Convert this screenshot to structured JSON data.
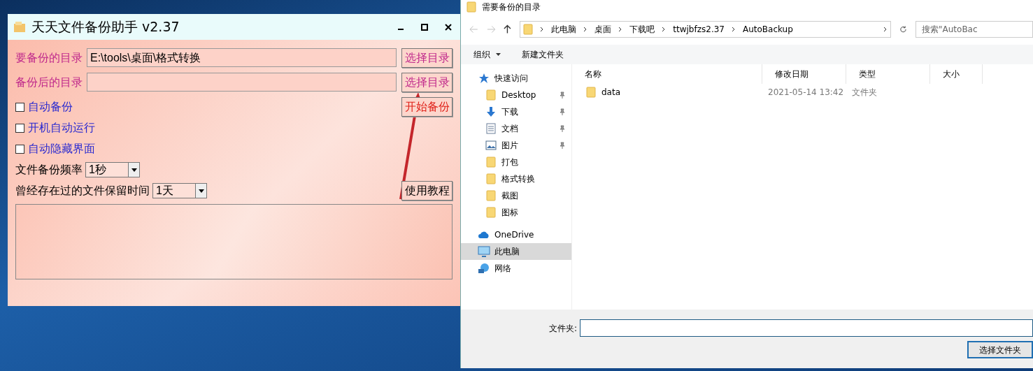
{
  "app": {
    "title": "天天文件备份助手 v2.37",
    "dir_rows": [
      {
        "label": "要备份的目录",
        "value": "E:\\tools\\桌面\\格式转换",
        "button": "选择目录"
      },
      {
        "label": "备份后的目录",
        "value": "",
        "button": "选择目录"
      }
    ],
    "start_button": "开始备份",
    "options": [
      {
        "label": "自动备份",
        "checked": false
      },
      {
        "label": "开机自动运行",
        "checked": false
      },
      {
        "label": "自动隐藏界面",
        "checked": false
      }
    ],
    "frequency": {
      "label": "文件备份频率",
      "value": "1秒"
    },
    "retention": {
      "label": "曾经存在过的文件保留时间",
      "value": "1天"
    },
    "tutorial_button": "使用教程"
  },
  "dialog": {
    "title": "需要备份的目录",
    "breadcrumb": [
      "此电脑",
      "桌面",
      "下载吧",
      "ttwjbfzs2.37",
      "AutoBackup"
    ],
    "search": {
      "placeholder": "搜索\"AutoBac"
    },
    "toolbar": [
      {
        "label": "组织",
        "kind": "menu"
      },
      {
        "label": "新建文件夹",
        "kind": "plain"
      }
    ],
    "nav": [
      {
        "label": "快速访问",
        "kind": "star",
        "pinned": false,
        "selected": false,
        "children": [
          {
            "label": "Desktop",
            "kind": "folder",
            "pinned": true,
            "selected": false
          },
          {
            "label": "下载",
            "kind": "download",
            "pinned": true,
            "selected": false
          },
          {
            "label": "文档",
            "kind": "document",
            "pinned": true,
            "selected": false
          },
          {
            "label": "图片",
            "kind": "picture",
            "pinned": true,
            "selected": false
          },
          {
            "label": "打包",
            "kind": "folder",
            "pinned": false,
            "selected": false
          },
          {
            "label": "格式转换",
            "kind": "folder",
            "pinned": false,
            "selected": false
          },
          {
            "label": "截图",
            "kind": "folder",
            "pinned": false,
            "selected": false
          },
          {
            "label": "图标",
            "kind": "folder",
            "pinned": false,
            "selected": false
          }
        ]
      },
      {
        "label": "OneDrive",
        "kind": "cloud",
        "pinned": false,
        "selected": false
      },
      {
        "label": "此电脑",
        "kind": "computer",
        "pinned": false,
        "selected": true
      },
      {
        "label": "网络",
        "kind": "network",
        "pinned": false,
        "selected": false
      }
    ],
    "columns": [
      "名称",
      "修改日期",
      "类型",
      "大小"
    ],
    "rows": [
      {
        "name": "data",
        "date": "2021-05-14 13:42",
        "type": "文件夹",
        "size": ""
      }
    ],
    "folder_label": "文件夹:",
    "select_button": "选择文件夹"
  }
}
